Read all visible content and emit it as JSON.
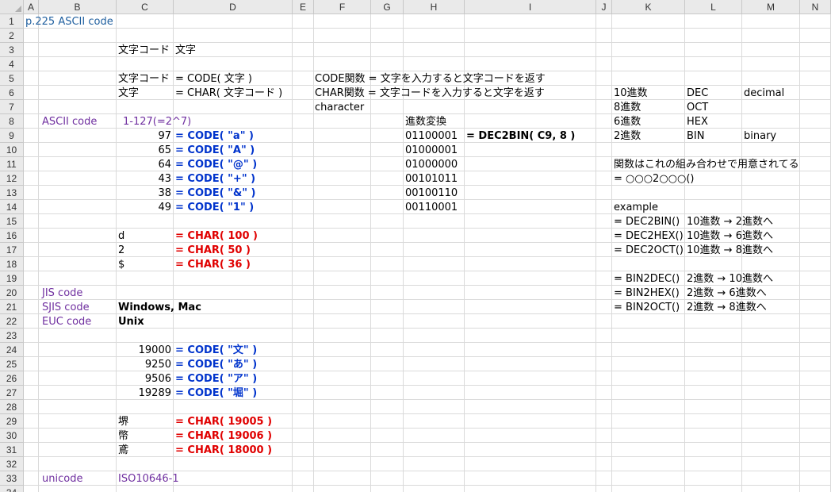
{
  "columns": [
    "A",
    "B",
    "C",
    "D",
    "E",
    "F",
    "G",
    "H",
    "I",
    "J",
    "K",
    "L",
    "M",
    "N"
  ],
  "rows": [
    "1",
    "2",
    "3",
    "4",
    "5",
    "6",
    "7",
    "8",
    "9",
    "10",
    "11",
    "12",
    "13",
    "14",
    "15",
    "16",
    "17",
    "18",
    "19",
    "20",
    "21",
    "22",
    "23",
    "24",
    "25",
    "26",
    "27",
    "28",
    "29",
    "30",
    "31",
    "32",
    "33",
    "34"
  ],
  "cells": {
    "A1": "p.225 ASCII code",
    "C3": "文字コード",
    "D3": "文字",
    "C5": "文字コード",
    "D5": "= CODE( 文字 )",
    "F5": "CODE関数 = 文字を入力すると文字コードを返す",
    "C6": "文字",
    "D6": "= CHAR( 文字コード )",
    "F6": "CHAR関数 = 文字コードを入力すると文字を返す",
    "K6": "10進数",
    "L6": "DEC",
    "M6": "decimal",
    "F7": "character",
    "K7": "8進数",
    "L7": "OCT",
    "B8": "ASCII code",
    "C8": "1-127(=2^7)",
    "H8": "進数変換",
    "K8": "6進数",
    "L8": "HEX",
    "C9": "97",
    "D9": "= CODE( \"a\" )",
    "H9": "01100001",
    "I9": "= DEC2BIN( C9, 8 )",
    "K9": "2進数",
    "L9": "BIN",
    "M9": "binary",
    "C10": "65",
    "D10": "= CODE( \"A\" )",
    "H10": "01000001",
    "C11": "64",
    "D11": "= CODE( \"@\" )",
    "H11": "01000000",
    "K11": "関数はこれの組み合わせで用意されてる",
    "C12": "43",
    "D12": "= CODE( \"+\" )",
    "H12": "00101011",
    "K12": "= ○○○2○○○()",
    "C13": "38",
    "D13": "= CODE( \"&\" )",
    "H13": "00100110",
    "C14": "49",
    "D14": "= CODE( \"1\" )",
    "H14": "00110001",
    "K14": "example",
    "K15": "= DEC2BIN()",
    "L15": "10進数 → 2進数へ",
    "C16": "d",
    "D16": "= CHAR( 100 )",
    "K16": "= DEC2HEX()",
    "L16": "10進数 → 6進数へ",
    "C17": "2",
    "D17": "= CHAR( 50 )",
    "K17": "= DEC2OCT()",
    "L17": "10進数 → 8進数へ",
    "C18": "$",
    "D18": "= CHAR( 36 )",
    "K19": "= BIN2DEC()",
    "L19": "2進数 → 10進数へ",
    "B20": "JIS code",
    "K20": "= BIN2HEX()",
    "L20": "2進数 → 6進数へ",
    "B21": "SJIS code",
    "C21": "Windows, Mac",
    "K21": "= BIN2OCT()",
    "L21": "2進数 → 8進数へ",
    "B22": "EUC code",
    "C22": "Unix",
    "C24": "19000",
    "D24": "= CODE( \"文\" )",
    "C25": "9250",
    "D25": "= CODE( \"あ\" )",
    "C26": "9506",
    "D26": "= CODE( \"ア\" )",
    "C27": "19289",
    "D27": "= CODE( \"堀\" )",
    "C29": "堺",
    "D29": "= CHAR( 19005 )",
    "C30": "幣",
    "D30": "= CHAR( 19006 )",
    "C31": "鳶",
    "D31": "= CHAR( 18000 )",
    "B33": "unicode",
    "C33": "ISO10646-1"
  },
  "colors": {
    "title": "#1f5f9f",
    "label": "#7030a0",
    "code_formula": "#0033cc",
    "char_formula": "#e00000"
  }
}
